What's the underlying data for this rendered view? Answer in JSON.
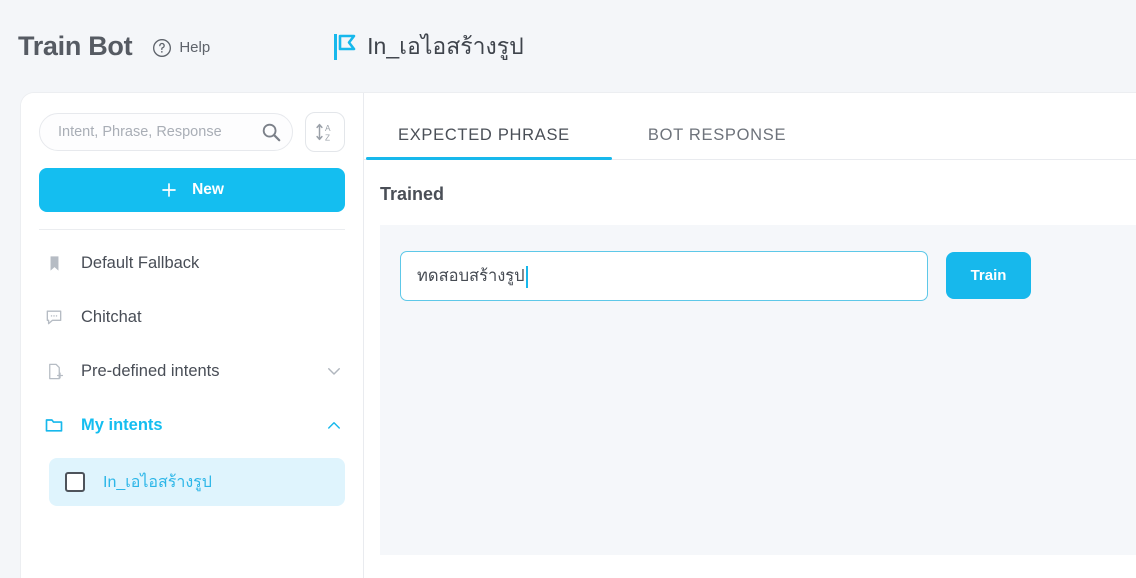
{
  "header": {
    "brand": "Train Bot",
    "help_label": "Help",
    "help_icon": "question-circle-icon",
    "bot_logo_icon": "flag-logo-icon",
    "bot_title": "In_เอไอสร้างรูป"
  },
  "sidebar": {
    "search": {
      "placeholder": "Intent, Phrase, Response",
      "value": "",
      "icon": "search-icon"
    },
    "sort_button": {
      "icon": "sort-az-icon",
      "label": ""
    },
    "new_button": {
      "label": "New",
      "icon": "plus-icon"
    },
    "items": [
      {
        "label": "Default Fallback",
        "icon": "bookmark-icon",
        "expandable": false,
        "accent": false
      },
      {
        "label": "Chitchat",
        "icon": "chat-bubble-icon",
        "expandable": false,
        "accent": false
      },
      {
        "label": "Pre-defined intents",
        "icon": "file-plus-icon",
        "expandable": true,
        "chevron": "chevron-down-icon",
        "accent": false
      },
      {
        "label": "My intents",
        "icon": "folder-icon",
        "expandable": true,
        "chevron": "chevron-up-icon",
        "accent": true
      }
    ],
    "selected_child": {
      "label": "In_เอไอสร้างรูป",
      "checked": false
    }
  },
  "main": {
    "tabs": [
      {
        "label": "EXPECTED PHRASE",
        "active": true
      },
      {
        "label": "BOT RESPONSE",
        "active": false
      }
    ],
    "section_title": "Trained",
    "phrase_input": {
      "value": "ทดสอบสร้างรูป",
      "placeholder": ""
    },
    "train_button": {
      "label": "Train"
    }
  },
  "colors": {
    "accent": "#17b8ec",
    "accent_strong": "#14bef0",
    "page_bg": "#f4f6f9",
    "panel_bg": "#f5f7fa",
    "selected_row_bg": "#dff4fd",
    "text_dark": "#484d56",
    "text_muted": "#6e737b"
  }
}
